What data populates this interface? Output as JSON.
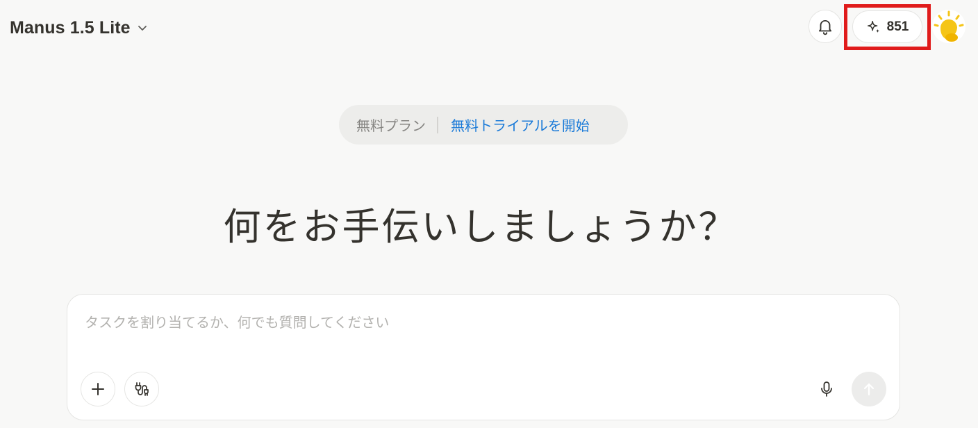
{
  "header": {
    "model_name": "Manus 1.5 Lite",
    "model_chevron_icon": "chevron-down-icon",
    "notification_icon": "bell-icon",
    "credits": {
      "icon": "sparkle-icon",
      "value": "851",
      "highlight_color": "#e01b1b"
    },
    "avatar_icon": "sun-avatar-icon"
  },
  "plan_banner": {
    "plan_label": "無料プラン",
    "trial_link": "無料トライアルを開始",
    "link_color": "#1a7ad8"
  },
  "greeting": "何をお手伝いしましょうか？",
  "composer": {
    "placeholder": "タスクを割り当てるか、何でも質問してください",
    "add_icon": "plus-icon",
    "connectors_icon": "plug-icon",
    "mic_icon": "microphone-icon",
    "send_icon": "arrow-up-icon"
  }
}
